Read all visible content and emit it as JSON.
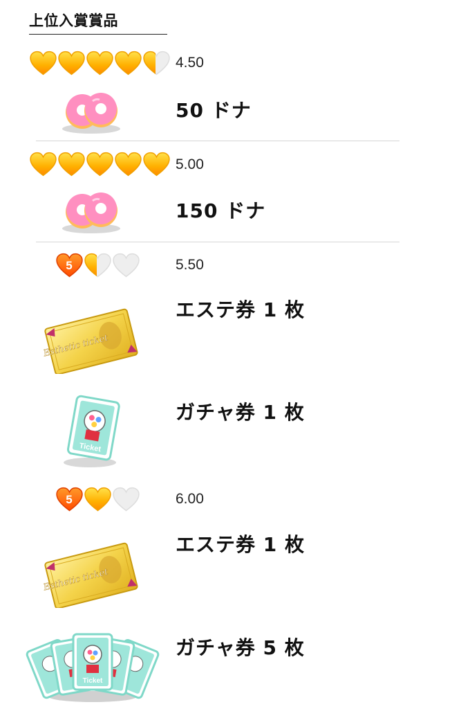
{
  "section": {
    "title": "上位入賞賞品"
  },
  "tiers": [
    {
      "score": "4.50",
      "hearts": [
        1,
        1,
        1,
        1,
        0.5
      ],
      "level_badge": "",
      "rewards": [
        {
          "icon": "donut-icon",
          "label": "50 ドナ"
        }
      ]
    },
    {
      "score": "5.00",
      "hearts": [
        1,
        1,
        1,
        1,
        1
      ],
      "level_badge": "",
      "rewards": [
        {
          "icon": "donut-icon",
          "label": "150 ドナ"
        }
      ]
    },
    {
      "score": "5.50",
      "hearts": [
        0.5,
        0,
        0
      ],
      "level_badge": "5",
      "rewards": [
        {
          "icon": "esthetic-ticket-icon",
          "label": "エステ券 1 枚",
          "ticket_text": "Esthetic ticket"
        },
        {
          "icon": "gacha-ticket-icon",
          "label": "ガチャ券 1 枚",
          "ticket_text": "Ticket"
        }
      ]
    },
    {
      "score": "6.00",
      "hearts": [
        1,
        0,
        0
      ],
      "level_badge": "5",
      "rewards": [
        {
          "icon": "esthetic-ticket-icon",
          "label": "エステ券 1 枚",
          "ticket_text": "Esthetic ticket"
        },
        {
          "icon": "gacha-ticket-stack-icon",
          "label": "ガチャ券 5 枚",
          "ticket_text": "Ticket"
        }
      ]
    }
  ],
  "colors": {
    "heart_gold": "#ffb000",
    "heart_orange": "#ff6a00",
    "heart_empty": "#eeeeee",
    "donut_pink": "#ff8fc0",
    "ticket_gold": "#f4d34a",
    "gacha_teal": "#6fd3c3"
  }
}
